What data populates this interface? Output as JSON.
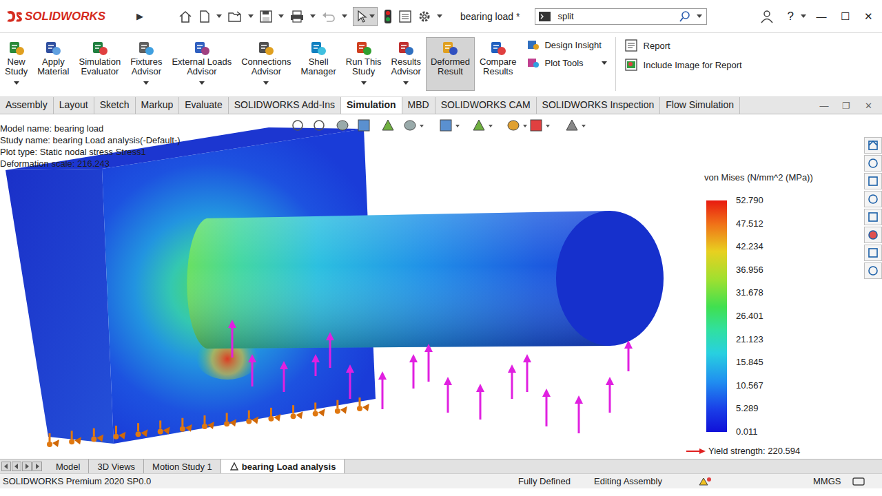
{
  "window": {
    "app": "SOLIDWORKS",
    "expand": "▶",
    "title": "bearing load *",
    "help": "?",
    "controls": [
      "—",
      "☐",
      "✕"
    ]
  },
  "search": {
    "value": "split"
  },
  "ribbon": {
    "buttons": [
      {
        "lines": [
          "New",
          "Study"
        ],
        "dropdown": true,
        "selected": false
      },
      {
        "lines": [
          "Apply",
          "Material"
        ],
        "dropdown": false,
        "selected": false
      },
      {
        "lines": [
          "Simulation",
          "Evaluator"
        ],
        "dropdown": false,
        "selected": false
      },
      {
        "lines": [
          "Fixtures",
          "Advisor"
        ],
        "dropdown": true,
        "selected": false
      },
      {
        "lines": [
          "External Loads",
          "Advisor"
        ],
        "dropdown": true,
        "selected": false
      },
      {
        "lines": [
          "Connections",
          "Advisor"
        ],
        "dropdown": true,
        "selected": false
      },
      {
        "lines": [
          "Shell",
          "Manager"
        ],
        "dropdown": false,
        "selected": false
      },
      {
        "lines": [
          "Run This",
          "Study"
        ],
        "dropdown": true,
        "selected": false
      },
      {
        "lines": [
          "Results",
          "Advisor"
        ],
        "dropdown": true,
        "selected": false
      },
      {
        "lines": [
          "Deformed",
          "Result"
        ],
        "dropdown": false,
        "selected": true
      },
      {
        "lines": [
          "Compare",
          "Results"
        ],
        "dropdown": false,
        "selected": false
      }
    ],
    "small": [
      {
        "label": "Design Insight",
        "dropdown": false
      },
      {
        "label": "Plot Tools",
        "dropdown": true
      }
    ],
    "report": [
      {
        "label": "Report"
      },
      {
        "label": "Include Image for Report"
      }
    ]
  },
  "tabs": [
    {
      "label": "Assembly",
      "selected": false
    },
    {
      "label": "Layout",
      "selected": false
    },
    {
      "label": "Sketch",
      "selected": false
    },
    {
      "label": "Markup",
      "selected": false
    },
    {
      "label": "Evaluate",
      "selected": false
    },
    {
      "label": "SOLIDWORKS Add-Ins",
      "selected": false
    },
    {
      "label": "Simulation",
      "selected": true
    },
    {
      "label": "MBD",
      "selected": false
    },
    {
      "label": "SOLIDWORKS CAM",
      "selected": false
    },
    {
      "label": "SOLIDWORKS Inspection",
      "selected": false
    },
    {
      "label": "Flow Simulation",
      "selected": false
    }
  ],
  "document_controls": [
    "—",
    "❐",
    "✕"
  ],
  "graphics": {
    "info": [
      "Model name: bearing load",
      "Study name: bearing Load analysis(-Default-)",
      "Plot type: Static nodal stress Stress1",
      "Deformation scale: 216.243"
    ],
    "legend": {
      "title": "von Mises (N/mm^2 (MPa))",
      "ticks": [
        "52.790",
        "47.512",
        "42.234",
        "36.956",
        "31.678",
        "26.401",
        "21.123",
        "15.845",
        "10.567",
        "5.289",
        "0.011"
      ],
      "yield": "Yield strength: 220.594"
    }
  },
  "bottom_tabs": [
    {
      "label": "Model",
      "selected": false
    },
    {
      "label": "3D Views",
      "selected": false
    },
    {
      "label": "Motion Study 1",
      "selected": false
    },
    {
      "label": "bearing Load analysis",
      "selected": true
    }
  ],
  "status_bar": {
    "product": "SOLIDWORKS Premium 2020 SP0.0",
    "state": "Fully Defined",
    "mode": "Editing Assembly",
    "units": "MMGS"
  }
}
